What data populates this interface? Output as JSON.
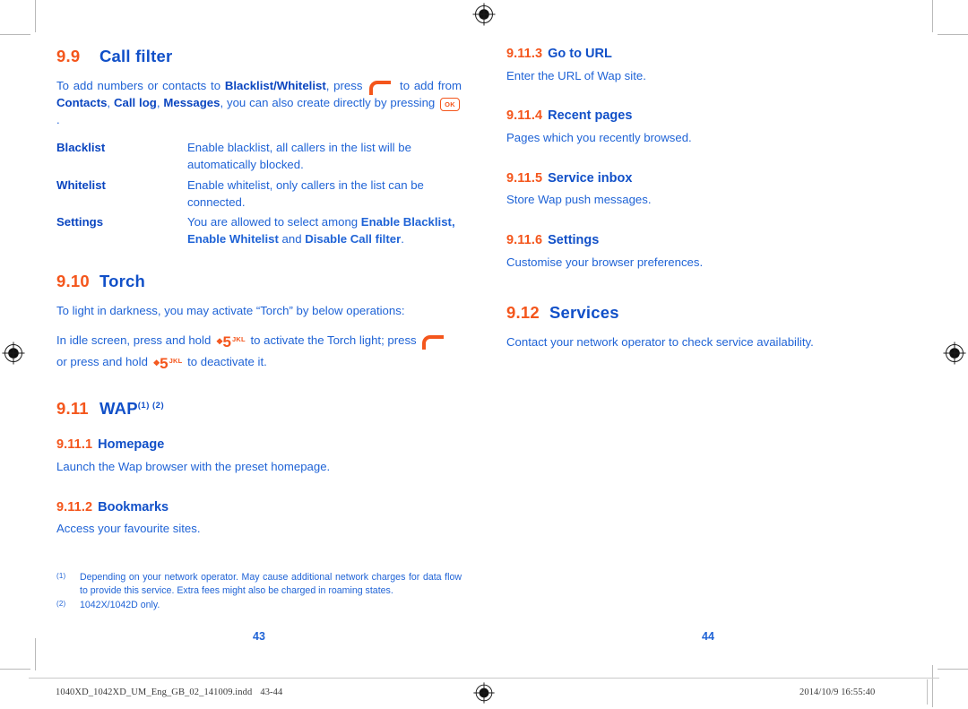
{
  "document": {
    "type": "printed-manual-spread",
    "colors": {
      "heading_orange": "#F4561C",
      "heading_blue": "#1150C8",
      "body_blue": "#1F63D6"
    }
  },
  "left_page": {
    "page_number": "43",
    "sections": [
      {
        "id": "call-filter",
        "number": "9.9",
        "title": "Call filter",
        "intro_parts": {
          "p1": "To add numbers or contacts to ",
          "b1": "Blacklist/Whitelist",
          "p2": ", press ",
          "icon1": "left-softkey-icon",
          "p3": " to add from ",
          "b2": "Contacts",
          "p4": ", ",
          "b3": "Call log",
          "p5": ", ",
          "b4": "Messages",
          "p6": ", you can also create directly by pressing ",
          "icon2": "ok-key-icon",
          "p7": "."
        },
        "definitions": [
          {
            "term": "Blacklist",
            "desc": "Enable blacklist, all callers in the list will be automatically blocked."
          },
          {
            "term": "Whitelist",
            "desc": "Enable whitelist, only callers in the list can be connected."
          },
          {
            "term": "Settings",
            "desc_p1": "You are allowed to select among ",
            "desc_b1": "Enable Blacklist,",
            "desc_b2": "Enable Whitelist",
            "desc_p2": " and ",
            "desc_b3": "Disable Call filter",
            "desc_p3": "."
          }
        ]
      },
      {
        "id": "torch",
        "number": "9.10",
        "title": "Torch",
        "paragraph_1": "To light in darkness, you may activate “Torch” by below operations:",
        "paragraph_2": {
          "p1": "In idle screen, press and hold ",
          "key1": "torch-5-jkl-key-icon",
          "p2": " to activate the Torch light; press ",
          "icon": "left-softkey-icon",
          "p3": " or press and hold ",
          "key2": "torch-5-jkl-key-icon",
          "p4": " to deactivate it."
        },
        "key_glyph": {
          "torch": "♩",
          "digit": "5",
          "letters": "JKL"
        }
      },
      {
        "id": "wap",
        "number": "9.11",
        "title": "WAP",
        "superscripts": "(1) (2)",
        "sub_sections": [
          {
            "number": "9.11.1",
            "title": "Homepage",
            "body": "Launch the Wap browser with the preset homepage."
          },
          {
            "number": "9.11.2",
            "title": "Bookmarks",
            "body": "Access your favourite sites."
          }
        ]
      }
    ],
    "footnotes": [
      {
        "mark": "(1)",
        "text": "Depending on your network operator. May cause additional network charges for data flow to provide this service. Extra fees might also be charged in roaming states."
      },
      {
        "mark": "(2)",
        "text": "1042X/1042D only."
      }
    ]
  },
  "right_page": {
    "page_number": "44",
    "sections": [
      {
        "kind": "sub",
        "number": "9.11.3",
        "title": "Go to URL",
        "body": "Enter the URL of Wap site."
      },
      {
        "kind": "sub",
        "number": "9.11.4",
        "title": "Recent pages",
        "body": "Pages which you recently browsed."
      },
      {
        "kind": "sub",
        "number": "9.11.5",
        "title": "Service inbox",
        "body": "Store Wap push messages."
      },
      {
        "kind": "sub",
        "number": "9.11.6",
        "title": "Settings",
        "body": "Customise your browser preferences."
      },
      {
        "kind": "main",
        "number": "9.12",
        "title": "Services",
        "body": "Contact your network operator to check service availability."
      }
    ]
  },
  "slug_bar": {
    "filename": "1040XD_1042XD_UM_Eng_GB_02_141009.indd",
    "page_range": "43-44",
    "timestamp": "2014/10/9   16:55:40"
  },
  "print_marks": {
    "registration_icon": "registration-target-icon",
    "crop_icon": "crop-mark"
  }
}
